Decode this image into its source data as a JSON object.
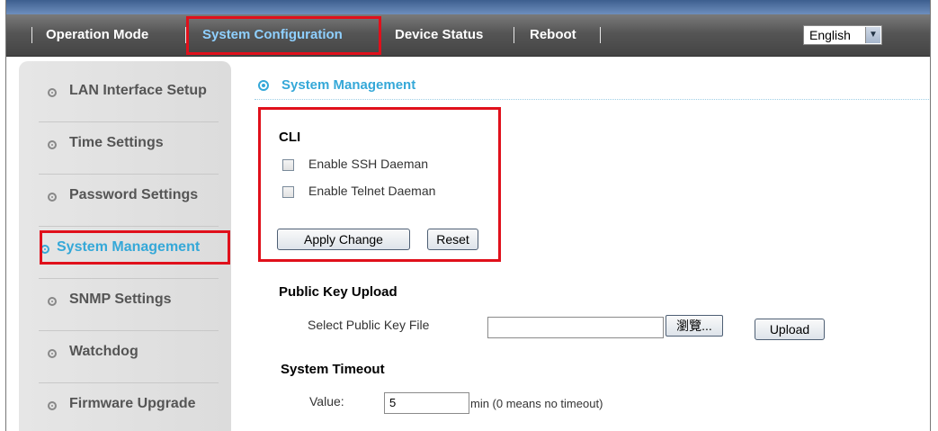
{
  "nav": {
    "items": [
      {
        "label": "Operation Mode"
      },
      {
        "label": "System Configuration"
      },
      {
        "label": "Device Status"
      },
      {
        "label": "Reboot"
      }
    ],
    "language": "English"
  },
  "sidebar": {
    "items": [
      {
        "label": "LAN Interface Setup"
      },
      {
        "label": "Time Settings"
      },
      {
        "label": "Password Settings"
      },
      {
        "label": "System Management"
      },
      {
        "label": "SNMP Settings"
      },
      {
        "label": "Watchdog"
      },
      {
        "label": "Firmware Upgrade"
      }
    ],
    "active_index": 3
  },
  "main": {
    "title": "System Management",
    "cli": {
      "heading": "CLI",
      "ssh_label": "Enable SSH Daeman",
      "telnet_label": "Enable Telnet Daeman",
      "ssh_checked": false,
      "telnet_checked": false,
      "apply_label": "Apply Change",
      "reset_label": "Reset"
    },
    "public_key": {
      "heading": "Public Key Upload",
      "select_label": "Select Public Key File",
      "file_value": "",
      "browse_label": "瀏覽...",
      "upload_label": "Upload"
    },
    "timeout": {
      "heading": "System Timeout",
      "value_label": "Value:",
      "value": "5",
      "unit_label": "min (0 means no timeout)"
    }
  },
  "colors": {
    "accent": "#35a8d8",
    "highlight": "#e0101b"
  }
}
